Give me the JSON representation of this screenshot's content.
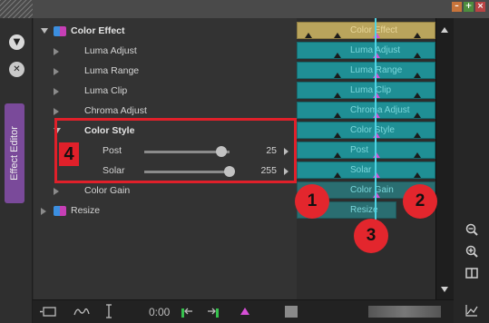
{
  "window": {
    "min_label": "–",
    "max_label": "+",
    "close_label": "×"
  },
  "left_strip": {
    "dropdown_glyph": "▼",
    "close_glyph": "✕",
    "tab_label": "Effect Editor"
  },
  "tree": {
    "items": [
      {
        "label": "Color Effect"
      },
      {
        "label": "Luma Adjust"
      },
      {
        "label": "Luma Range"
      },
      {
        "label": "Luma Clip"
      },
      {
        "label": "Chroma Adjust"
      },
      {
        "label": "Color Style"
      },
      {
        "label": "Post",
        "value": "25",
        "level": 0.9
      },
      {
        "label": "Solar",
        "value": "255",
        "level": 1.0
      },
      {
        "label": "Color Gain"
      },
      {
        "label": "Resize"
      }
    ]
  },
  "timeline": {
    "bars": [
      {
        "label": "Color Effect"
      },
      {
        "label": "Luma Adjust"
      },
      {
        "label": "Luma Range"
      },
      {
        "label": "Luma Clip"
      },
      {
        "label": "Chroma Adjust"
      },
      {
        "label": "Color Style"
      },
      {
        "label": "Post"
      },
      {
        "label": "Solar"
      },
      {
        "label": "Color Gain"
      },
      {
        "label": "Resize"
      }
    ]
  },
  "bottom_bar": {
    "timecode": "0:00"
  },
  "annotations": {
    "box_number": "4",
    "badge1": "1",
    "badge2": "2",
    "badge3": "3"
  },
  "colors": {
    "timeline_teal": "#1f8f95",
    "timeline_gold": "#b9a45c",
    "playhead": "#4fd3e3",
    "keyframe_pink": "#d64fd6",
    "annotation_red": "#e0202a",
    "tab_purple": "#7a4a9a"
  },
  "icons": {
    "zoom_out": "zoom-out-icon",
    "zoom_in": "zoom-in-icon",
    "split": "split-view-icon",
    "graph": "graph-icon"
  }
}
